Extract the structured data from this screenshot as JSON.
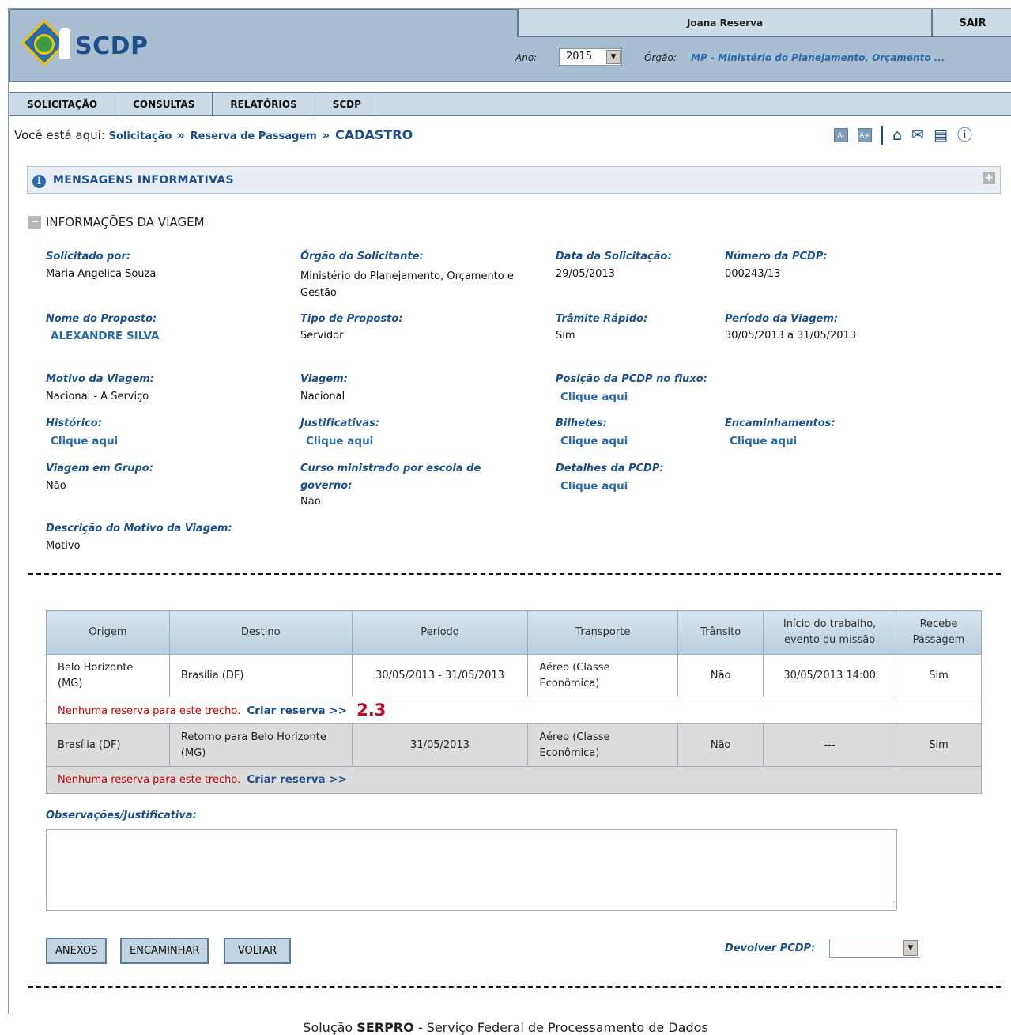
{
  "header": {
    "logo_text": "SCDP",
    "user_name": "Joana Reserva",
    "logout_label": "SAIR",
    "ano_label": "Ano:",
    "ano_value": "2015",
    "orgao_label": "Órgão:",
    "orgao_value": "MP - Ministério do Planejamento, Orçamento ..."
  },
  "menu": [
    {
      "label": "SOLICITAÇÃO"
    },
    {
      "label": "CONSULTAS"
    },
    {
      "label": "RELATÓRIOS"
    },
    {
      "label": "SCDP"
    }
  ],
  "breadcrumb": {
    "prefix": "Você está aqui:",
    "items": [
      "Solicitação",
      "Reserva de Passagem"
    ],
    "current": "CADASTRO",
    "separator": "»"
  },
  "tools": {
    "font_decrease": "A-",
    "font_increase": "A+",
    "icons": [
      "home-icon",
      "mail-icon",
      "chat-icon",
      "help-icon"
    ]
  },
  "messages": {
    "title": "MENSAGENS INFORMATIVAS"
  },
  "trip_info": {
    "section_title": "INFORMAÇÕES DA VIAGEM",
    "fields": {
      "solicitado_por": {
        "label": "Solicitado por:",
        "value": "Maria Angelica Souza"
      },
      "orgao_solicitante": {
        "label": "Órgão do Solicitante:",
        "value": "Ministério do Planejamento, Orçamento e Gestão"
      },
      "data_solicitacao": {
        "label": "Data da Solicitação:",
        "value": "29/05/2013"
      },
      "numero_pcdp": {
        "label": "Número da PCDP:",
        "value": "000243/13"
      },
      "nome_proposto": {
        "label": "Nome do Proposto:",
        "value": "ALEXANDRE SILVA"
      },
      "tipo_proposto": {
        "label": "Tipo de Proposto:",
        "value": "Servidor"
      },
      "tramite_rapido": {
        "label": "Trâmite Rápido:",
        "value": "Sim"
      },
      "periodo_viagem": {
        "label": "Período da Viagem:",
        "value": "30/05/2013 a 31/05/2013"
      },
      "motivo_viagem": {
        "label": "Motivo da Viagem:",
        "value": "Nacional - A Serviço"
      },
      "viagem": {
        "label": "Viagem:",
        "value": "Nacional"
      },
      "posicao_pcdp": {
        "label": "Posição da PCDP no fluxo:",
        "link": "Clique aqui"
      },
      "historico": {
        "label": "Histórico:",
        "link": "Clique aqui"
      },
      "justificativas": {
        "label": "Justificativas:",
        "link": "Clique aqui"
      },
      "bilhetes": {
        "label": "Bilhetes:",
        "link": "Clique aqui"
      },
      "encaminhamentos": {
        "label": "Encaminhamentos:",
        "link": "Clique aqui"
      },
      "viagem_grupo": {
        "label": "Viagem em Grupo:",
        "value": "Não"
      },
      "curso_ministrado": {
        "label_line1": "Curso ministrado por escola de",
        "label_line2": "governo:",
        "value": "Não"
      },
      "detalhes_pcdp": {
        "label": "Detalhes da PCDP:",
        "link": "Clique aqui"
      },
      "descricao_motivo": {
        "label": "Descrição do Motivo da Viagem:",
        "value": "Motivo"
      }
    }
  },
  "trechos": {
    "headers": [
      "Origem",
      "Destino",
      "Período",
      "Transporte",
      "Trânsito",
      "Início do trabalho, evento ou missão",
      "Recebe Passagem"
    ],
    "rows": [
      {
        "origem": "Belo Horizonte (MG)",
        "destino": "Brasília (DF)",
        "periodo": "30/05/2013 - 31/05/2013",
        "transporte": "Aéreo (Classe Econômica)",
        "transito": "Não",
        "inicio": "30/05/2013 14:00",
        "recebe": "Sim",
        "note": "Nenhuma reserva para este trecho.",
        "action": "Criar reserva >>",
        "step": "2.3"
      },
      {
        "origem": "Brasília (DF)",
        "destino": "Retorno para Belo Horizonte (MG)",
        "periodo": "31/05/2013",
        "transporte": "Aéreo (Classe Econômica)",
        "transito": "Não",
        "inicio": "---",
        "recebe": "Sim",
        "note": "Nenhuma reserva para este trecho.",
        "action": "Criar reserva >>"
      }
    ]
  },
  "observacoes": {
    "label": "Observações/Justificativa:",
    "value": ""
  },
  "actions": {
    "anexos": "ANEXOS",
    "encaminhar": "ENCAMINHAR",
    "voltar": "VOLTAR",
    "devolver_label": "Devolver PCDP:",
    "devolver_value": ""
  },
  "footer": {
    "prefix": "Solução",
    "brand": "SERPRO",
    "suffix": "- Serviço Federal de Processamento de Dados"
  }
}
